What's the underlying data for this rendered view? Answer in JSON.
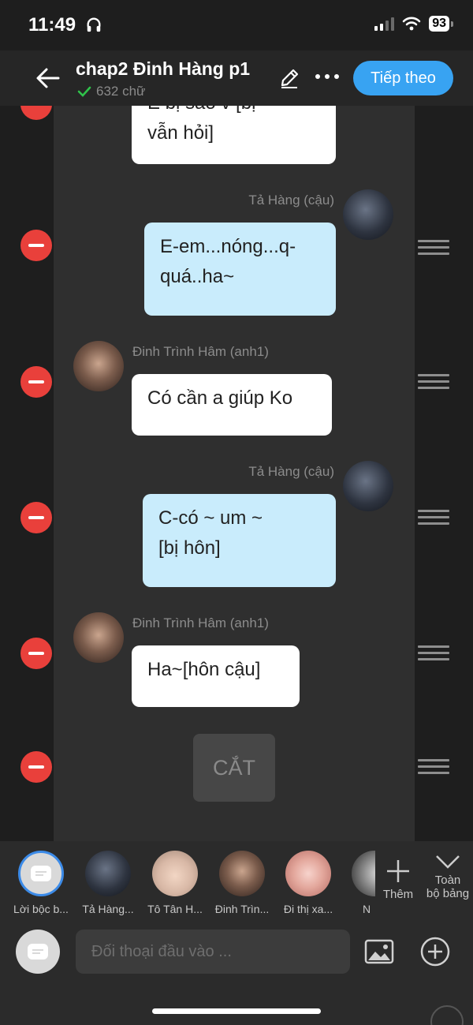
{
  "status": {
    "time": "11:49",
    "battery": "93"
  },
  "header": {
    "title": "chap2 Đinh Hàng p1",
    "word_count": "632 chữ",
    "next_label": "Tiếp theo"
  },
  "messages": [
    {
      "side": "left",
      "speaker": "",
      "text_line1": "E bị sao v [bị",
      "text_line2": "vẫn hỏi]"
    },
    {
      "side": "right",
      "speaker": "Tả Hàng (cậu)",
      "text_line1": "E-em...nóng...q-",
      "text_line2": "quá..ha~"
    },
    {
      "side": "left",
      "speaker": "Đinh Trình Hâm (anh1)",
      "text": "Có cần a giúp Ko"
    },
    {
      "side": "right",
      "speaker": "Tả Hàng (cậu)",
      "text_line1": "C-có ~ um ~",
      "text_line2": "[bị hôn]"
    },
    {
      "side": "left",
      "speaker": "Đinh Trình Hâm (anh1)",
      "text": "Ha~[hôn cậu]"
    }
  ],
  "cut_label": "CẮT",
  "characters": [
    {
      "label": "Lời bộc b..."
    },
    {
      "label": "Tả Hàng..."
    },
    {
      "label": "Tô Tân H..."
    },
    {
      "label": "Đinh Trìn..."
    },
    {
      "label": "Đi thị xa..."
    },
    {
      "label": "N"
    }
  ],
  "add_label": "Thêm",
  "expand_label_line1": "Toàn",
  "expand_label_line2": "bộ bảng",
  "input_placeholder": "Đối thoại đầu vào ...",
  "colors": {
    "accent": "#38a3f2",
    "delete": "#e9403b",
    "bubble_blue": "#c9ecfc",
    "check": "#2fc24a"
  }
}
